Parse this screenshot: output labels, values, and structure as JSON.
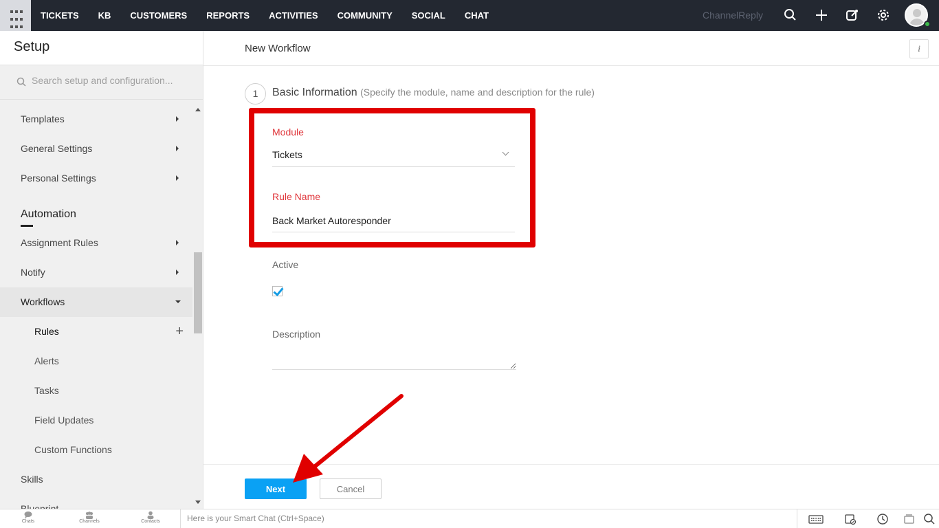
{
  "topnav": {
    "items": [
      "TICKETS",
      "KB",
      "CUSTOMERS",
      "REPORTS",
      "ACTIVITIES",
      "COMMUNITY",
      "SOCIAL",
      "CHAT"
    ],
    "brand": "ChannelReply",
    "icons": [
      "search-icon",
      "plus-icon",
      "compose-icon",
      "gear-icon"
    ]
  },
  "sidebar": {
    "title": "Setup",
    "search_placeholder": "Search setup and configuration...",
    "items": [
      {
        "label": "Templates"
      },
      {
        "label": "General Settings"
      },
      {
        "label": "Personal Settings"
      }
    ],
    "section": "Automation",
    "automation_items": [
      {
        "label": "Assignment Rules"
      },
      {
        "label": "Notify"
      },
      {
        "label": "Workflows"
      }
    ],
    "workflow_sub": [
      {
        "label": "Rules"
      },
      {
        "label": "Alerts"
      },
      {
        "label": "Tasks"
      },
      {
        "label": "Field Updates"
      },
      {
        "label": "Custom Functions"
      }
    ],
    "after": [
      {
        "label": "Skills"
      },
      {
        "label": "Blueprint"
      }
    ]
  },
  "main": {
    "title": "New Workflow",
    "info_label": "i",
    "step_number": "1",
    "step_title": "Basic Information",
    "step_note": "(Specify the module, name and description for the rule)",
    "module_label": "Module",
    "module_value": "Tickets",
    "rule_name_label": "Rule Name",
    "rule_name_value": "Back Market Autoresponder",
    "active_label": "Active",
    "active_checked": true,
    "description_label": "Description",
    "next_label": "Next",
    "cancel_label": "Cancel"
  },
  "bottombar": {
    "items": [
      "Chats",
      "Channels",
      "Contacts"
    ],
    "chat_placeholder": "Here is your Smart Chat (Ctrl+Space)"
  },
  "colors": {
    "topbar": "#232831",
    "accent": "#0aa1f4",
    "highlight": "#e00000",
    "field_label": "#e0363b"
  }
}
